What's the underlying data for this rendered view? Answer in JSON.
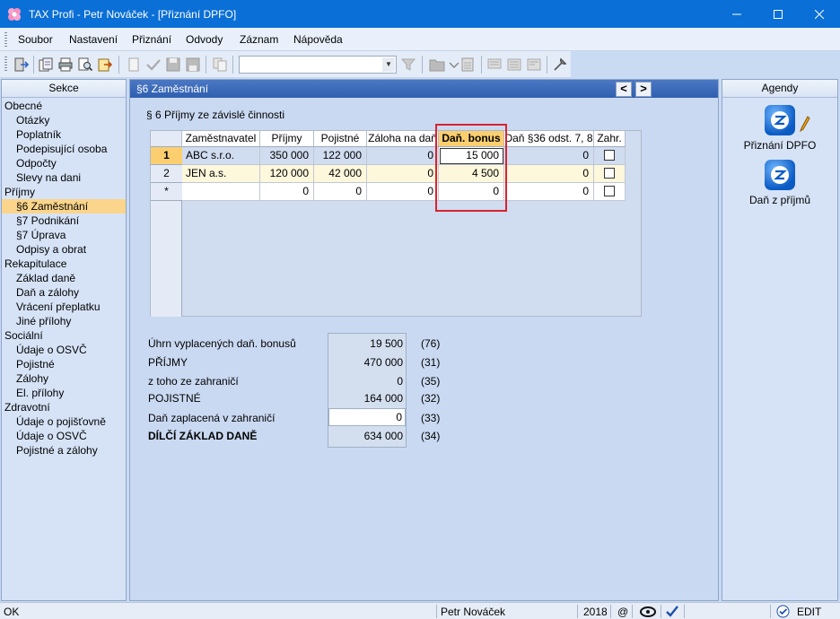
{
  "window": {
    "title": "TAX Profi - Petr Nováček - [Přiznání DPFO]"
  },
  "menu": [
    {
      "label": "Soubor"
    },
    {
      "label": "Nastavení"
    },
    {
      "label": "Přiznání"
    },
    {
      "label": "Odvody"
    },
    {
      "label": "Záznam"
    },
    {
      "label": "Nápověda"
    }
  ],
  "toolbar": {
    "combo_value": ""
  },
  "sidebar": {
    "title": "Sekce",
    "items": [
      {
        "label": "Obecné",
        "level": 0
      },
      {
        "label": "Otázky",
        "level": 1
      },
      {
        "label": "Poplatník",
        "level": 1
      },
      {
        "label": "Podepisující osoba",
        "level": 1
      },
      {
        "label": "Odpočty",
        "level": 1
      },
      {
        "label": "Slevy na dani",
        "level": 1
      },
      {
        "label": "Příjmy",
        "level": 0
      },
      {
        "label": "§6 Zaměstnání",
        "level": 1,
        "selected": true
      },
      {
        "label": "§7 Podnikání",
        "level": 1
      },
      {
        "label": "§7 Úprava",
        "level": 1
      },
      {
        "label": "Odpisy a obrat",
        "level": 1
      },
      {
        "label": "Rekapitulace",
        "level": 0
      },
      {
        "label": "Základ daně",
        "level": 1
      },
      {
        "label": "Daň a zálohy",
        "level": 1
      },
      {
        "label": "Vrácení přeplatku",
        "level": 1
      },
      {
        "label": "Jiné přílohy",
        "level": 1
      },
      {
        "label": "Sociální",
        "level": 0
      },
      {
        "label": "Údaje o OSVČ",
        "level": 1
      },
      {
        "label": "Pojistné",
        "level": 1
      },
      {
        "label": "Zálohy",
        "level": 1
      },
      {
        "label": "El. přílohy",
        "level": 1
      },
      {
        "label": "Zdravotní",
        "level": 0
      },
      {
        "label": "Údaje o pojišťovně",
        "level": 1
      },
      {
        "label": "Údaje o OSVČ",
        "level": 1
      },
      {
        "label": "Pojistné a zálohy",
        "level": 1
      }
    ]
  },
  "main": {
    "header": "§6 Zaměstnání",
    "prev_label": "<",
    "next_label": ">",
    "section_title": "§ 6  Příjmy ze závislé činnosti",
    "grid": {
      "columns": [
        "Zaměstnavatel",
        "Příjmy",
        "Pojistné",
        "Záloha na daň",
        "Daň. bonus",
        "Daň §36 odst. 7, 8",
        "Zahr."
      ],
      "rows": [
        {
          "head": "1",
          "cells": [
            "ABC s.r.o.",
            "350 000",
            "122 000",
            "0",
            "15 000",
            "0"
          ],
          "zahr": false
        },
        {
          "head": "2",
          "cells": [
            "JEN a.s.",
            "120 000",
            "42 000",
            "0",
            "4 500",
            "0"
          ],
          "zahr": false
        },
        {
          "head": "*",
          "cells": [
            "",
            "0",
            "0",
            "0",
            "0",
            "0"
          ],
          "zahr": false
        }
      ]
    },
    "summary": [
      {
        "label": "Úhrn vyplacených daň. bonusů",
        "value": "19 500",
        "code": "(76)"
      },
      {
        "label": "PŘÍJMY",
        "value": "470 000",
        "code": "(31)"
      },
      {
        "label": "z toho ze zahraničí",
        "value": "0",
        "code": "(35)"
      },
      {
        "label": "POJISTNÉ",
        "value": "164 000",
        "code": "(32)"
      },
      {
        "label": "Daň zaplacená v zahraničí",
        "value": "0",
        "code": "(33)"
      },
      {
        "label": "DÍLČÍ ZÁKLAD DANĚ",
        "value": "634 000",
        "code": "(34)"
      }
    ]
  },
  "agendy": {
    "title": "Agendy",
    "items": [
      {
        "label": "Přiznání DPFO",
        "icon": "dpfo-icon"
      },
      {
        "label": "Daň z příjmů",
        "icon": "dan-z-prijmu-icon"
      }
    ]
  },
  "status": {
    "left": "OK",
    "user": "Petr Nováček",
    "year": "2018",
    "at": "@",
    "mode": "EDIT"
  },
  "colors": {
    "titlebar": "#0a6fd6",
    "selection": "#fbd58b",
    "highlight": "#d9232e"
  }
}
